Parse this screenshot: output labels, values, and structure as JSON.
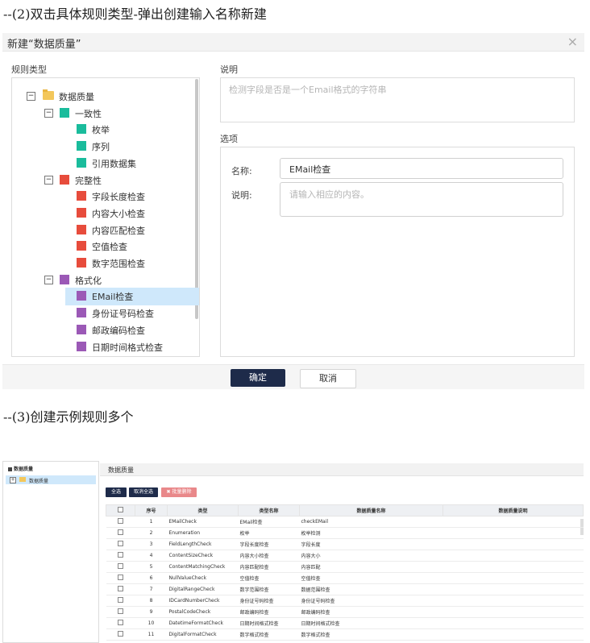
{
  "captions": {
    "step2": "--(2)双击具体规则类型-弹出创建输入名称新建",
    "step3": "--(3)创建示例规则多个"
  },
  "dialog": {
    "title": "新建“数据质量”",
    "close_glyph": "×",
    "rule_type_label": "规则类型",
    "description_label": "说明",
    "description_placeholder": "检测字段是否是一个Email格式的字符串",
    "options_label": "选项",
    "name_label": "名称:",
    "name_value": "EMail检查",
    "desc_label": "说明:",
    "desc_placeholder": "请输入相应的内容。",
    "ok_label": "确定",
    "cancel_label": "取消",
    "tree": {
      "root": "数据质量",
      "groups": [
        {
          "label": "一致性",
          "color": "#1abc9c",
          "items": [
            "枚举",
            "序列",
            "引用数据集"
          ]
        },
        {
          "label": "完整性",
          "color": "#e74c3c",
          "items": [
            "字段长度检查",
            "内容大小检查",
            "内容匹配检查",
            "空值检查",
            "数字范围检查"
          ]
        },
        {
          "label": "格式化",
          "color": "#9b59b6",
          "items": [
            "EMail检查",
            "身份证号码检查",
            "邮政编码检查",
            "日期时间格式检查"
          ]
        }
      ],
      "selected": "EMail检查",
      "expander_glyph": "−"
    }
  },
  "rules_screen": {
    "sidebar_title": "数据质量",
    "sidebar_node": "数据质量",
    "sidebar_expander": "+",
    "panel_title": "数据质量",
    "buttons": {
      "select_all": "全选",
      "deselect_all": "取消全选",
      "batch_delete": "✖ 批量删除"
    },
    "columns": [
      "",
      "序号",
      "类型",
      "类型名称",
      "数据质量名称",
      "数据质量说明"
    ],
    "rows": [
      {
        "no": "1",
        "type": "EMailCheck",
        "type_name": "EMail检查",
        "dq_name": "checkEMail",
        "dq_desc": ""
      },
      {
        "no": "2",
        "type": "Enumeration",
        "type_name": "枚举",
        "dq_name": "枚举检测",
        "dq_desc": ""
      },
      {
        "no": "3",
        "type": "FieldLengthCheck",
        "type_name": "字段长度检查",
        "dq_name": "字段长度",
        "dq_desc": ""
      },
      {
        "no": "4",
        "type": "ContentSizeCheck",
        "type_name": "内容大小检查",
        "dq_name": "内容大小",
        "dq_desc": ""
      },
      {
        "no": "5",
        "type": "ContentMatchingCheck",
        "type_name": "内容匹配检查",
        "dq_name": "内容匹配",
        "dq_desc": ""
      },
      {
        "no": "6",
        "type": "NullValueCheck",
        "type_name": "空值检查",
        "dq_name": "空值检查",
        "dq_desc": ""
      },
      {
        "no": "7",
        "type": "DigitalRangeCheck",
        "type_name": "数字范围检查",
        "dq_name": "数据范围检查",
        "dq_desc": ""
      },
      {
        "no": "8",
        "type": "IDCardNumberCheck",
        "type_name": "身份证号码检查",
        "dq_name": "身份证号码检查",
        "dq_desc": ""
      },
      {
        "no": "9",
        "type": "PostalCodeCheck",
        "type_name": "邮政编码检查",
        "dq_name": "邮政编码检查",
        "dq_desc": ""
      },
      {
        "no": "10",
        "type": "DatetimeFormatCheck",
        "type_name": "日期时间格式检查",
        "dq_name": "日期时间格式检查",
        "dq_desc": ""
      },
      {
        "no": "11",
        "type": "DigitalFormatCheck",
        "type_name": "数字格式检查",
        "dq_name": "数字格式检查",
        "dq_desc": ""
      }
    ]
  },
  "colors": {
    "primary_button": "#1e2b4a",
    "selected_row": "#cfe8fb",
    "danger_button": "#e9888a"
  }
}
